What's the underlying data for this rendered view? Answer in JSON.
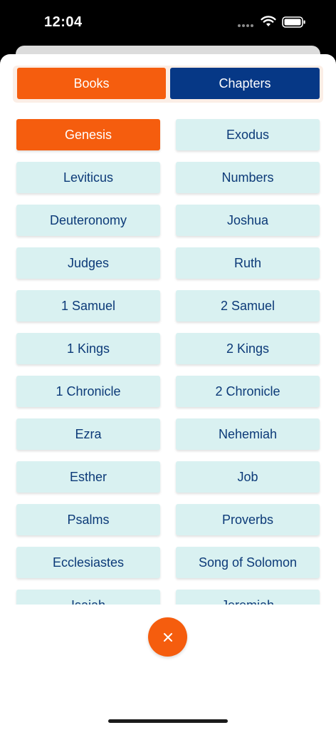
{
  "status_bar": {
    "time": "12:04"
  },
  "tabs": {
    "books": "Books",
    "chapters": "Chapters"
  },
  "books": [
    {
      "label": "Genesis",
      "selected": true
    },
    {
      "label": "Exodus"
    },
    {
      "label": "Leviticus"
    },
    {
      "label": "Numbers"
    },
    {
      "label": "Deuteronomy"
    },
    {
      "label": "Joshua"
    },
    {
      "label": "Judges"
    },
    {
      "label": "Ruth"
    },
    {
      "label": "1 Samuel"
    },
    {
      "label": "2 Samuel"
    },
    {
      "label": "1 Kings"
    },
    {
      "label": "2 Kings"
    },
    {
      "label": "1 Chronicle"
    },
    {
      "label": "2 Chronicle"
    },
    {
      "label": "Ezra"
    },
    {
      "label": "Nehemiah"
    },
    {
      "label": "Esther"
    },
    {
      "label": "Job"
    },
    {
      "label": "Psalms"
    },
    {
      "label": "Proverbs"
    },
    {
      "label": "Ecclesiastes"
    },
    {
      "label": "Song of Solomon"
    },
    {
      "label": "Isaiah"
    },
    {
      "label": "Jeremiah"
    }
  ],
  "colors": {
    "accent": "#f55d0e",
    "navy": "#063886",
    "book_bg": "#d9f1f1",
    "book_text": "#0c3a78"
  },
  "icons": {
    "wifi": "wifi-icon",
    "battery": "battery-icon",
    "close": "close-icon"
  }
}
